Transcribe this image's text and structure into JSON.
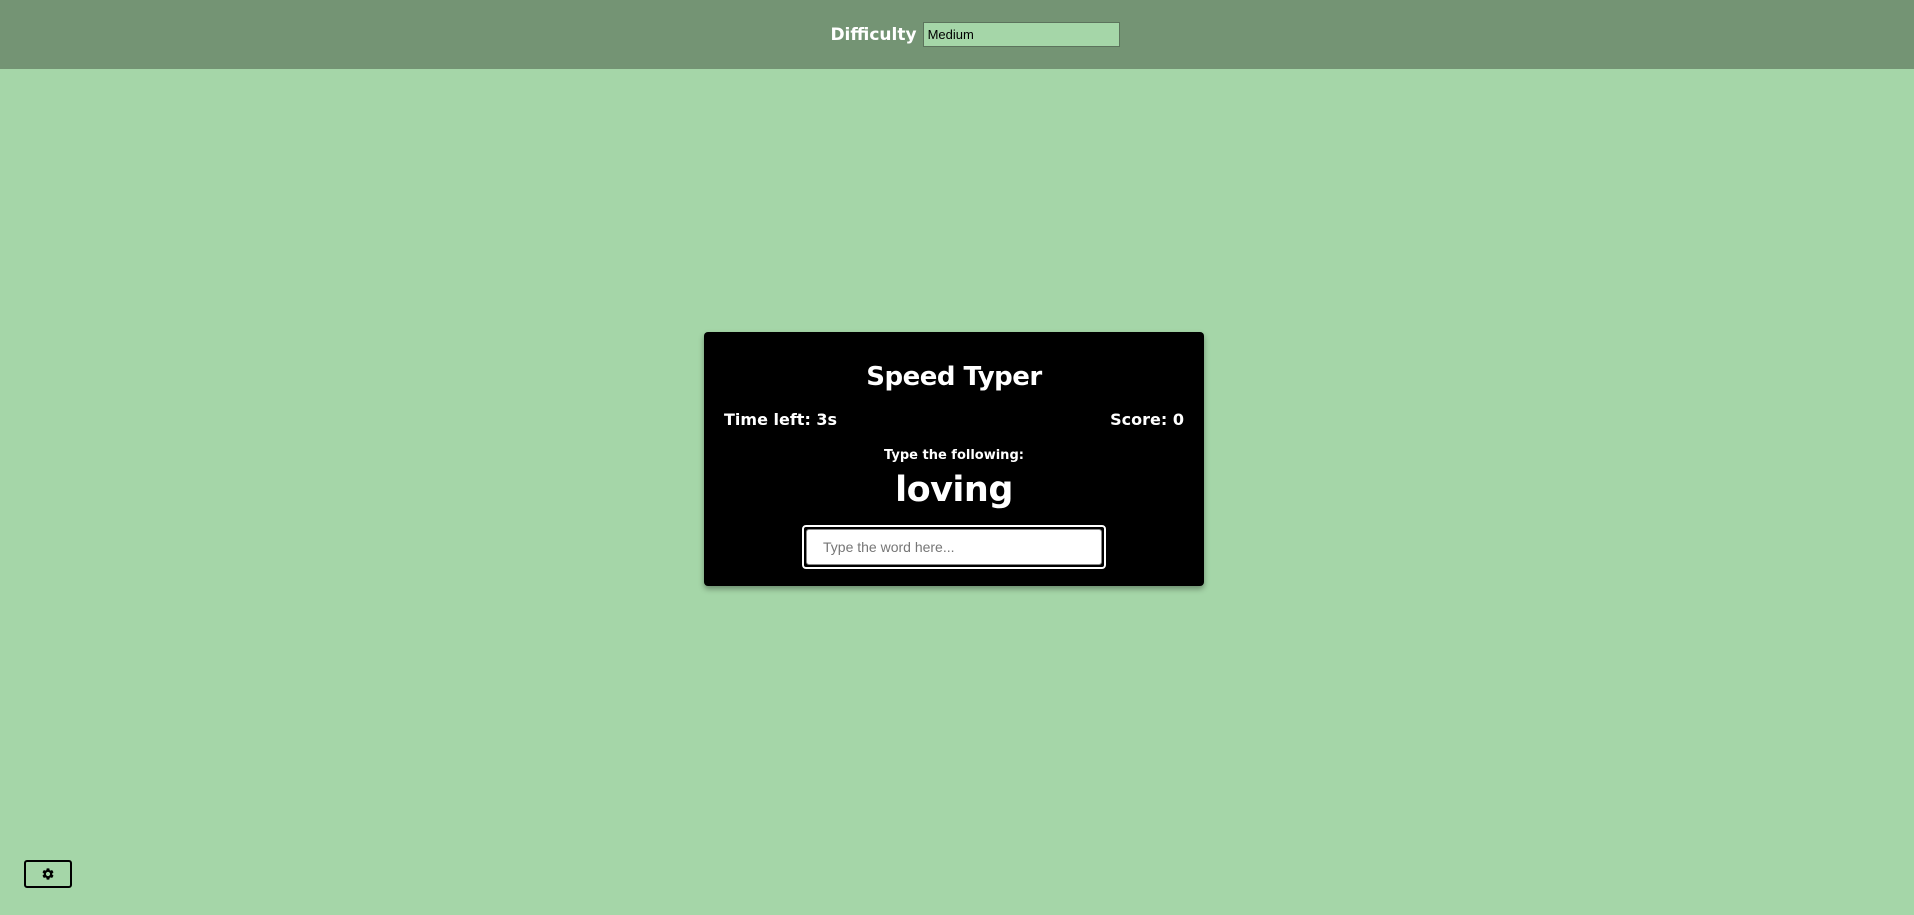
{
  "header": {
    "difficulty_label": "Difficulty",
    "difficulty_value": "Medium"
  },
  "game": {
    "title": "Speed Typer",
    "time_left": "Time left: 3s",
    "score": "Score: 0",
    "prompt_label": "Type the following:",
    "word": "loving",
    "input_placeholder": "Type the word here...",
    "input_value": ""
  },
  "settings": {
    "icon": "gear-icon"
  },
  "colors": {
    "background": "#a5d6a8",
    "topbar": "#749474",
    "card": "#000000",
    "text_light": "#ffffff"
  }
}
